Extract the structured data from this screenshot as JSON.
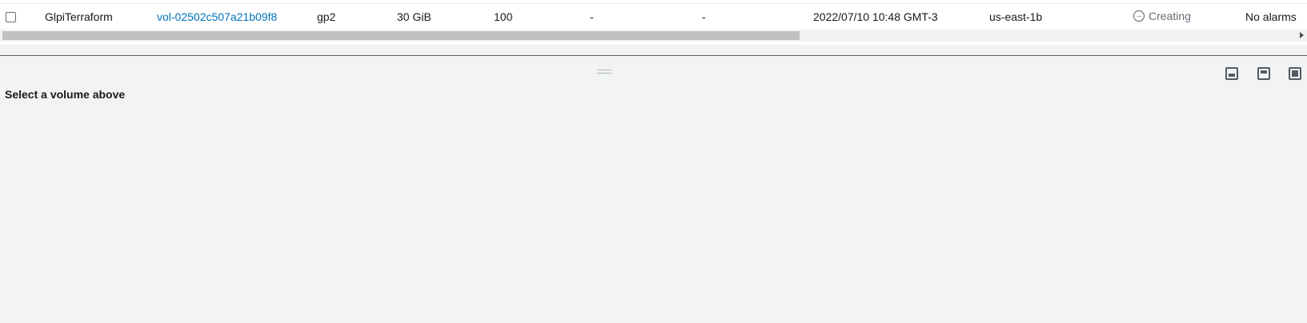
{
  "volume_row": {
    "name": "GlpiTerraform",
    "volume_id": "vol-02502c507a21b09f8",
    "type": "gp2",
    "size": "30 GiB",
    "iops": "100",
    "throughput": "-",
    "snapshot": "-",
    "created": "2022/07/10 10:48 GMT-3",
    "availability_zone": "us-east-1b",
    "state": "Creating",
    "alarm_status": "No alarms",
    "status_icon": "ellipsis-circle-icon"
  },
  "detail_panel": {
    "message": "Select a volume above"
  },
  "colors": {
    "link": "#0073bb",
    "status_text": "#687078",
    "panel_background": "#f2f3f3"
  }
}
